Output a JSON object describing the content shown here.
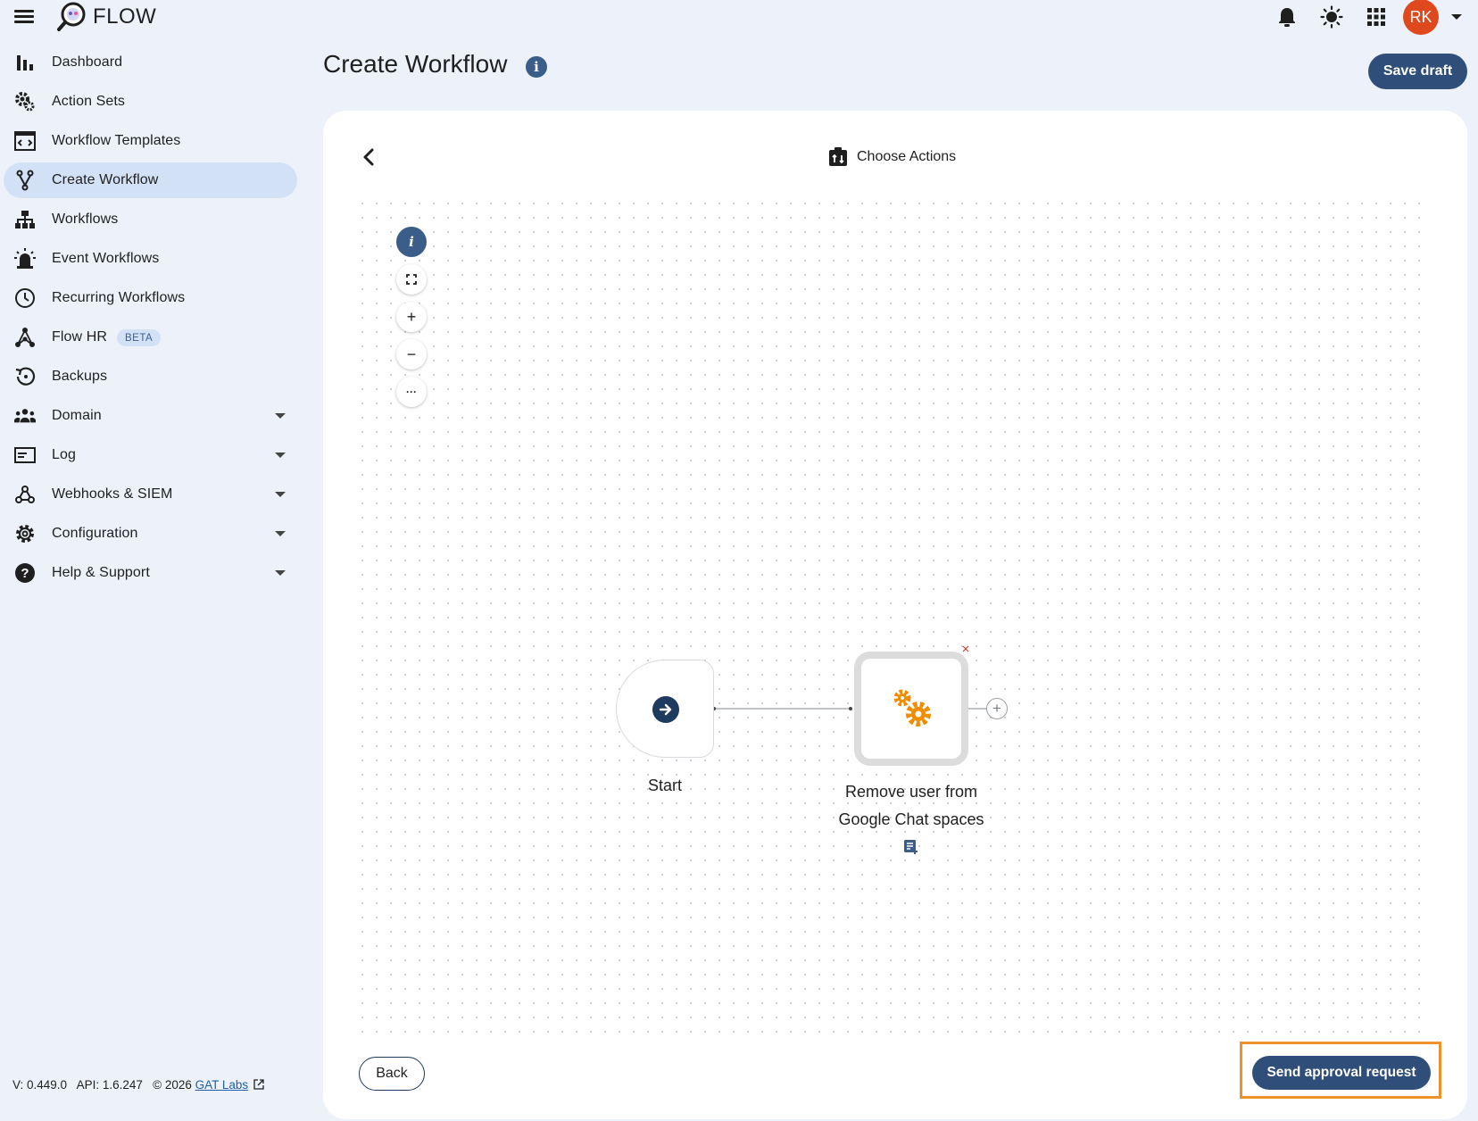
{
  "app": {
    "brand": "FLOW",
    "user_initials": "RK",
    "avatar_color": "#e0491d",
    "accent_color": "#2f4f7a"
  },
  "topbar": {
    "icons": [
      "hamburger-menu-icon",
      "notifications-bell-icon",
      "brightness-icon",
      "apps-grid-icon",
      "account-menu-caret-icon"
    ]
  },
  "sidebar": {
    "items": [
      {
        "label": "Dashboard",
        "icon": "bar-chart-icon"
      },
      {
        "label": "Action Sets",
        "icon": "gears-icon"
      },
      {
        "label": "Workflow Templates",
        "icon": "template-icon"
      },
      {
        "label": "Create Workflow",
        "icon": "fork-icon",
        "active": true
      },
      {
        "label": "Workflows",
        "icon": "hierarchy-icon"
      },
      {
        "label": "Event Workflows",
        "icon": "siren-icon"
      },
      {
        "label": "Recurring Workflows",
        "icon": "clock-icon"
      },
      {
        "label": "Flow HR",
        "icon": "network-icon",
        "badge": "BETA"
      },
      {
        "label": "Backups",
        "icon": "restore-icon"
      },
      {
        "label": "Domain",
        "icon": "people-icon",
        "expandable": true
      },
      {
        "label": "Log",
        "icon": "log-icon",
        "expandable": true
      },
      {
        "label": "Webhooks & SIEM",
        "icon": "webhook-icon",
        "expandable": true
      },
      {
        "label": "Configuration",
        "icon": "gear-icon",
        "expandable": true
      },
      {
        "label": "Help & Support",
        "icon": "help-icon",
        "expandable": true
      }
    ]
  },
  "footer": {
    "version": "V: 0.449.0",
    "api": "API: 1.6.247",
    "copyright": "© 2026",
    "company_link": "GAT Labs"
  },
  "header": {
    "title": "Create Workflow",
    "info_icon_text": "i",
    "save_draft": "Save draft"
  },
  "card": {
    "step_title": "Choose Actions",
    "controls": {
      "info": "i",
      "zoom_in": "+",
      "zoom_out": "−",
      "more": "···"
    },
    "nodes": {
      "start_label": "Start",
      "action_label_line1": "Remove user from",
      "action_label_line2": "Google Chat spaces",
      "delete_symbol": "×",
      "add_symbol": "+"
    },
    "back_button": "Back",
    "send_button": "Send approval request",
    "highlight_color": "#f0922b"
  }
}
